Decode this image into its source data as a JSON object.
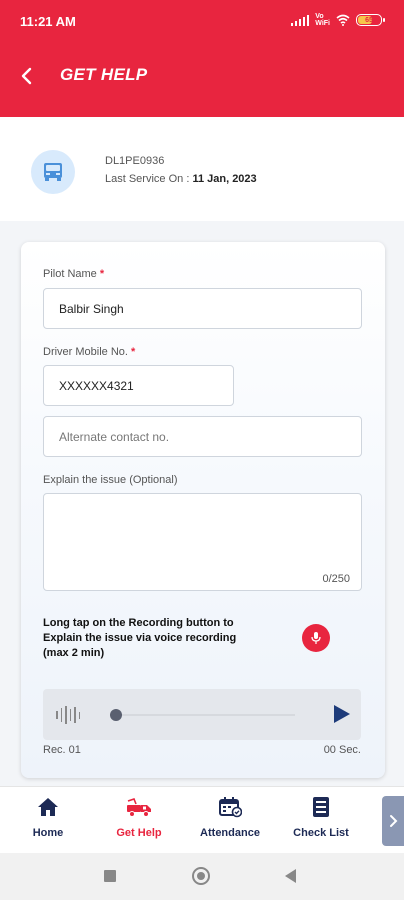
{
  "status_bar": {
    "time": "11:21 AM",
    "network": "Vo WiFi",
    "battery": "65"
  },
  "header": {
    "title": "GET HELP"
  },
  "vehicle": {
    "id": "DL1PE0936",
    "service_label": "Last Service On :",
    "service_date": "11 Jan, 2023",
    "icon": "truck-icon"
  },
  "form": {
    "pilot_name": {
      "label": "Pilot Name",
      "required": "*",
      "value": "Balbir Singh"
    },
    "driver_mobile": {
      "label": "Driver Mobile No.",
      "required": "*",
      "value": "XXXXXX4321"
    },
    "alternate_contact": {
      "placeholder": "Alternate contact no."
    },
    "issue": {
      "label": "Explain the issue (Optional)",
      "value": "",
      "counter": "0/250"
    },
    "recording_instruction": "Long tap on the Recording button to Explain the issue via voice recording (max 2 min)",
    "player": {
      "name": "Rec. 01",
      "duration": "00 Sec.",
      "progress": 0
    }
  },
  "bottom_nav": {
    "items": [
      {
        "label": "Home",
        "icon": "home-icon"
      },
      {
        "label": "Get Help",
        "icon": "truck-tow-icon",
        "active": true
      },
      {
        "label": "Attendance",
        "icon": "calendar-icon"
      },
      {
        "label": "Check List",
        "icon": "checklist-icon"
      }
    ]
  },
  "colors": {
    "brand": "#e8253f",
    "nav_text": "#1d2a55",
    "vehicle_icon_bg": "#d8eafc",
    "vehicle_icon": "#4a90d9"
  }
}
